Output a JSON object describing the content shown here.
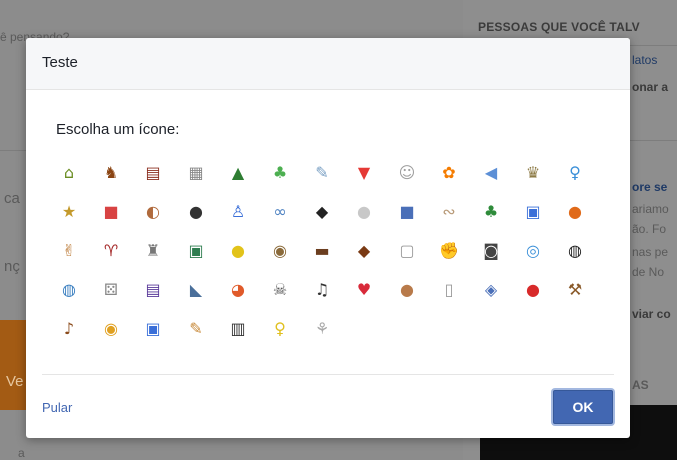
{
  "background": {
    "composer_hint": "ê pensando?",
    "people_header": "PESSOAS QUE VOCÊ TALV",
    "fragments": [
      "latos",
      "onar a",
      "ore se",
      "ariamo",
      "ão. Fo",
      "nas pe",
      "de No",
      "viar co",
      "AS",
      "ca",
      "nç",
      "Ve",
      "a"
    ]
  },
  "dialog": {
    "title": "Teste",
    "choose_label": "Escolha um ícone:",
    "skip_label": "Pular",
    "ok_label": "OK"
  },
  "icons": [
    {
      "name": "house-icon",
      "glyph": "⌂",
      "color": "#6b8e23"
    },
    {
      "name": "horse-icon",
      "glyph": "♞",
      "color": "#8b4513"
    },
    {
      "name": "furniture-icon",
      "glyph": "▤",
      "color": "#8b2e1f"
    },
    {
      "name": "calculator-icon",
      "glyph": "▦",
      "color": "#888888"
    },
    {
      "name": "tent-icon",
      "glyph": "▲",
      "color": "#2e7d32"
    },
    {
      "name": "plant-icon",
      "glyph": "♣",
      "color": "#4caf50"
    },
    {
      "name": "quill-icon",
      "glyph": "✎",
      "color": "#7aa0c4"
    },
    {
      "name": "cup-icon",
      "glyph": "▼",
      "color": "#e53935"
    },
    {
      "name": "theater-masks-icon",
      "glyph": "☺",
      "color": "#9e9e9e"
    },
    {
      "name": "flower-icon",
      "glyph": "✿",
      "color": "#f57c00"
    },
    {
      "name": "megaphone-icon",
      "glyph": "◀",
      "color": "#5c8fd6"
    },
    {
      "name": "trophy-icon",
      "glyph": "♛",
      "color": "#8d7b46"
    },
    {
      "name": "pin-icon",
      "glyph": "♀",
      "color": "#3a8fd8"
    },
    {
      "name": "star-badge-icon",
      "glyph": "★",
      "color": "#c49a2c"
    },
    {
      "name": "gift-icon",
      "glyph": "■",
      "color": "#d84343"
    },
    {
      "name": "planet-icon",
      "glyph": "◐",
      "color": "#b06a3c"
    },
    {
      "name": "hockey-puck-icon",
      "glyph": "●",
      "color": "#333333"
    },
    {
      "name": "flask-icon",
      "glyph": "♙",
      "color": "#3a6fd8"
    },
    {
      "name": "glasses-icon",
      "glyph": "∞",
      "color": "#4a7fc0"
    },
    {
      "name": "graduation-cap-icon",
      "glyph": "◆",
      "color": "#222222"
    },
    {
      "name": "baseball-icon",
      "glyph": "●",
      "color": "#c8c8c8"
    },
    {
      "name": "notebook-icon",
      "glyph": "■",
      "color": "#4a6fb8"
    },
    {
      "name": "bone-icon",
      "glyph": "∾",
      "color": "#b89a78"
    },
    {
      "name": "tree-icon",
      "glyph": "♣",
      "color": "#2e8b3a"
    },
    {
      "name": "thumbs-up-icon",
      "glyph": "▣",
      "color": "#3a6fd8"
    },
    {
      "name": "basketball-icon",
      "glyph": "●",
      "color": "#e06a1a"
    },
    {
      "name": "rock-hand-icon",
      "glyph": "✌",
      "color": "#b8732c"
    },
    {
      "name": "wine-glass-icon",
      "glyph": "♈",
      "color": "#a52a2a"
    },
    {
      "name": "chess-rook-icon",
      "glyph": "♜",
      "color": "#777777"
    },
    {
      "name": "chip-icon",
      "glyph": "▣",
      "color": "#2e7d4f"
    },
    {
      "name": "tennis-ball-icon",
      "glyph": "●",
      "color": "#e2c31a"
    },
    {
      "name": "paw-icon",
      "glyph": "◉",
      "color": "#8a6a3a"
    },
    {
      "name": "briefcase-icon",
      "glyph": "▬",
      "color": "#6b3e1f"
    },
    {
      "name": "football-icon",
      "glyph": "◆",
      "color": "#7a3a14"
    },
    {
      "name": "gamepad-icon",
      "glyph": "▢",
      "color": "#9a9a9a"
    },
    {
      "name": "fist-icon",
      "glyph": "✊",
      "color": "#c88a5a"
    },
    {
      "name": "camera-icon",
      "glyph": "◙",
      "color": "#444444"
    },
    {
      "name": "fishbowl-icon",
      "glyph": "◎",
      "color": "#3a8fd8"
    },
    {
      "name": "soccer-ball-icon",
      "glyph": "◍",
      "color": "#222222"
    },
    {
      "name": "globe-icon",
      "glyph": "◍",
      "color": "#3a7fc0"
    },
    {
      "name": "dice-icon",
      "glyph": "⚄",
      "color": "#888888"
    },
    {
      "name": "clapperboard-icon",
      "glyph": "▤",
      "color": "#5a3a9a"
    },
    {
      "name": "sneaker-icon",
      "glyph": "◣",
      "color": "#4a6f9a"
    },
    {
      "name": "beach-ball-icon",
      "glyph": "◕",
      "color": "#e05a2a"
    },
    {
      "name": "skull-icon",
      "glyph": "☠",
      "color": "#555555"
    },
    {
      "name": "music-sheet-icon",
      "glyph": "♫",
      "color": "#333333"
    },
    {
      "name": "heartbeat-icon",
      "glyph": "♥",
      "color": "#d82a3a"
    },
    {
      "name": "teddy-bear-icon",
      "glyph": "●",
      "color": "#b87a4a"
    },
    {
      "name": "mug-icon",
      "glyph": "▯",
      "color": "#9a9a9a"
    },
    {
      "name": "shield-icon",
      "glyph": "◈",
      "color": "#4a6fb8"
    },
    {
      "name": "apple-icon",
      "glyph": "●",
      "color": "#d82a2a"
    },
    {
      "name": "gavel-icon",
      "glyph": "⚒",
      "color": "#8a5a2a"
    },
    {
      "name": "guitar-icon",
      "glyph": "♪",
      "color": "#8a4a1a"
    },
    {
      "name": "coin-icon",
      "glyph": "◉",
      "color": "#e0a020"
    },
    {
      "name": "contacts-icon",
      "glyph": "▣",
      "color": "#3a6fd8"
    },
    {
      "name": "palette-icon",
      "glyph": "✎",
      "color": "#c88a3a"
    },
    {
      "name": "book-icon",
      "glyph": "▥",
      "color": "#333333"
    },
    {
      "name": "light-bulb-icon",
      "glyph": "♀",
      "color": "#e0c020"
    },
    {
      "name": "dove-icon",
      "glyph": "⚘",
      "color": "#a8a8a8"
    }
  ]
}
